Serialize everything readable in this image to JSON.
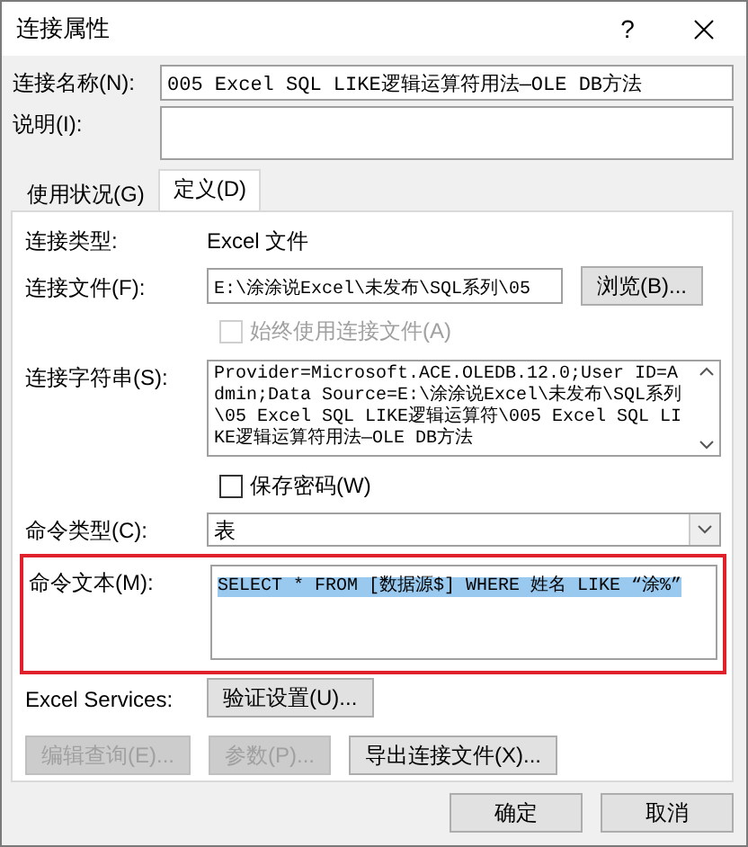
{
  "window": {
    "title": "连接属性",
    "help": "?"
  },
  "name": {
    "label": "连接名称(N):",
    "value": "005 Excel SQL LIKE逻辑运算符用法—OLE DB方法"
  },
  "description": {
    "label": "说明(I):"
  },
  "tabs": [
    {
      "label": "使用状况(G)",
      "selected": false
    },
    {
      "label": "定义(D)",
      "selected": true
    }
  ],
  "definition": {
    "connection_type": {
      "label": "连接类型:",
      "value": "Excel 文件"
    },
    "connection_file": {
      "label": "连接文件(F):",
      "value": "E:\\涂涂说Excel\\未发布\\SQL系列\\05",
      "button": "浏览(B)..."
    },
    "always_use_file": {
      "label": "始终使用连接文件(A)",
      "checked": false,
      "disabled": true
    },
    "connection_string": {
      "label": "连接字符串(S):",
      "value": "Provider=Microsoft.ACE.OLEDB.12.0;User ID=Admin;Data Source=E:\\涂涂说Excel\\未发布\\SQL系列\\05 Excel SQL LIKE逻辑运算符\\005 Excel SQL LIKE逻辑运算符用法—OLE DB方法"
    },
    "save_password": {
      "label": "保存密码(W)",
      "checked": false,
      "disabled": false
    },
    "command_type": {
      "label": "命令类型(C):",
      "value": "表"
    },
    "command_text": {
      "label": "命令文本(M):",
      "value": "SELECT * FROM [数据源$] WHERE 姓名 LIKE “涂%”",
      "selected": true,
      "highlighted": true
    },
    "excel_services": {
      "label": "Excel Services:",
      "button": "验证设置(U)..."
    },
    "buttons": [
      {
        "label": "编辑查询(E)...",
        "disabled": true
      },
      {
        "label": "参数(P)...",
        "disabled": true
      },
      {
        "label": "导出连接文件(X)...",
        "disabled": false
      }
    ]
  },
  "buttons": [
    {
      "label": "确定"
    },
    {
      "label": "取消"
    }
  ]
}
